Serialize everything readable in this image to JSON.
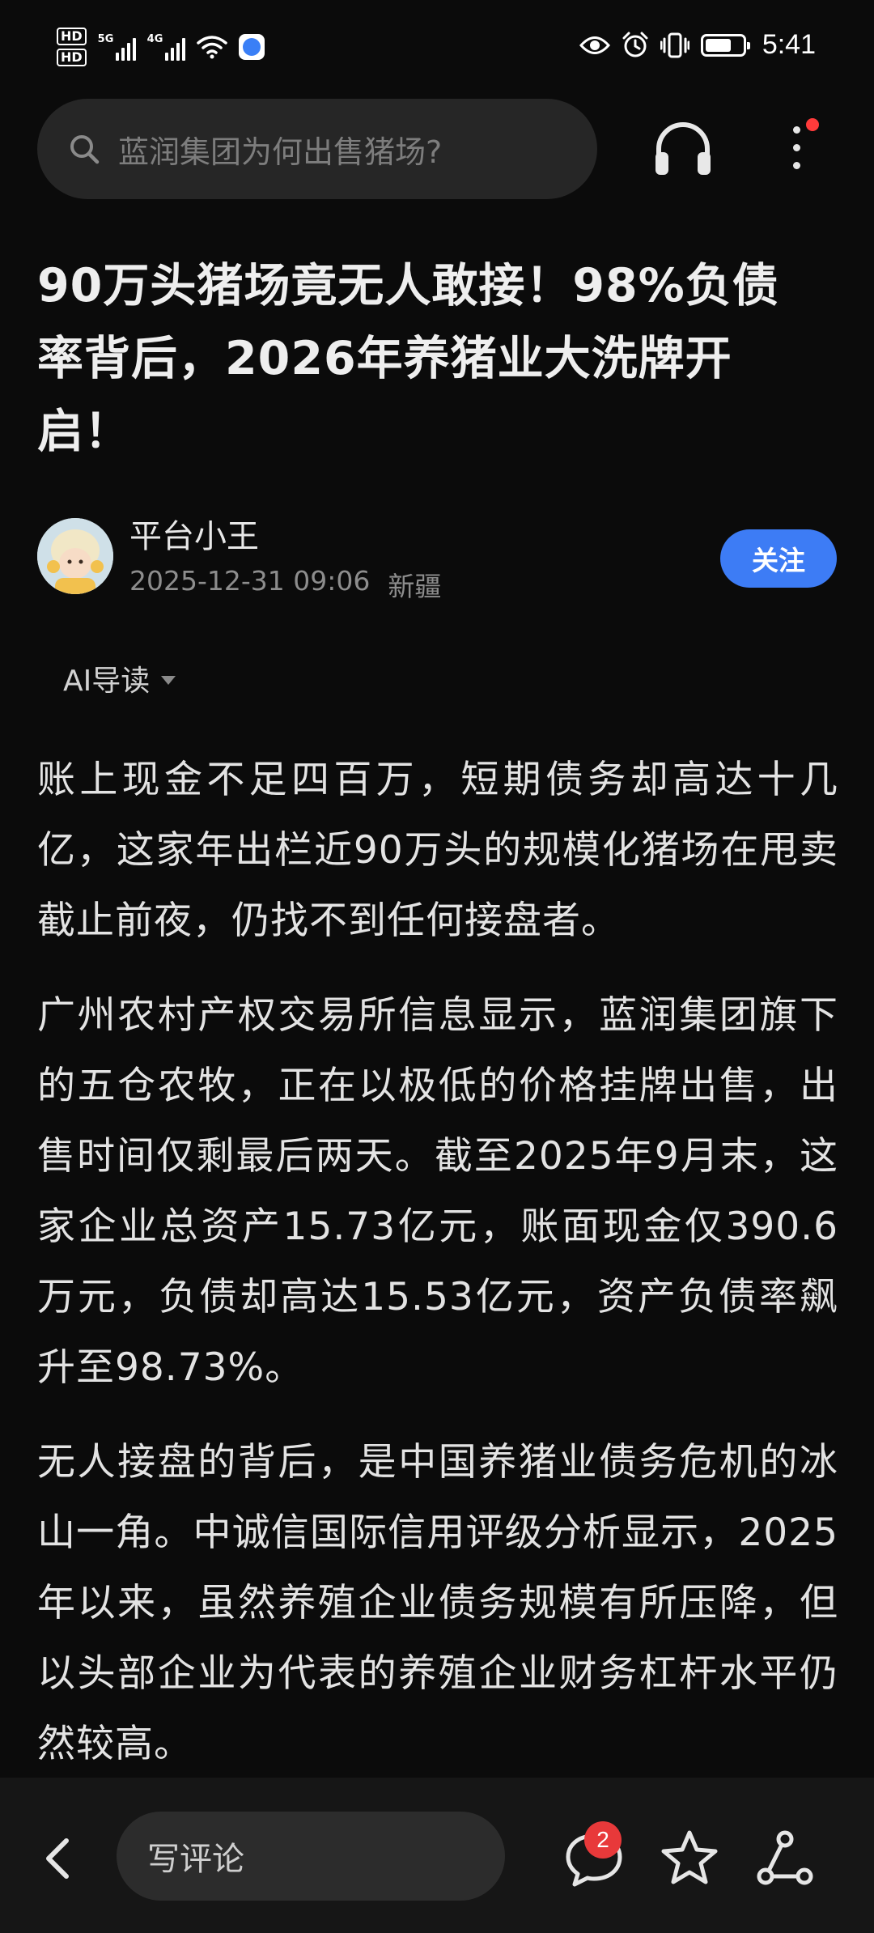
{
  "status_bar": {
    "hd1": "HD",
    "hd2": "HD",
    "net1": "5G",
    "net2": "4G",
    "time": "5:41",
    "battery_level": 0.7,
    "icons": [
      "wifi-icon",
      "browser-app-icon",
      "eye-icon",
      "alarm-icon",
      "vibrate-icon",
      "battery-icon"
    ]
  },
  "header": {
    "search_placeholder": "蓝润集团为何出售猪场?",
    "icons": [
      "search-icon",
      "headphone-icon",
      "more-icon"
    ]
  },
  "article": {
    "title": "90万头猪场竟无人敢接！98%负债率背后，2026年养猪业大洗牌开启！",
    "author": {
      "name": "平台小王",
      "date": "2025-12-31 09:06",
      "location": "新疆",
      "follow_label": "关注"
    },
    "ai_guide_label": "AI导读",
    "paragraphs": [
      "账上现金不足四百万，短期债务却高达十几亿，这家年出栏近90万头的规模化猪场在甩卖截止前夜，仍找不到任何接盘者。",
      "广州农村产权交易所信息显示，蓝润集团旗下的五仓农牧，正在以极低的价格挂牌出售，出售时间仅剩最后两天。截至2025年9月末，这家企业总资产15.73亿元，账面现金仅390.6万元，负债却高达15.53亿元，资产负债率飙升至98.73%。",
      "无人接盘的背后，是中国养猪业债务危机的冰山一角。中诚信国际信用评级分析显示，2025年以来，虽然养殖企业债务规模有所压降，但以头部企业为代表的养殖企业财务杠杆水平仍然较高。"
    ]
  },
  "bottom_bar": {
    "comment_placeholder": "写评论",
    "comment_count": "2",
    "icons": [
      "back-icon",
      "comment-icon",
      "star-icon",
      "share-icon"
    ]
  },
  "colors": {
    "background": "#0b0b0b",
    "accent": "#3d7cf5",
    "badge": "#e8393a"
  }
}
